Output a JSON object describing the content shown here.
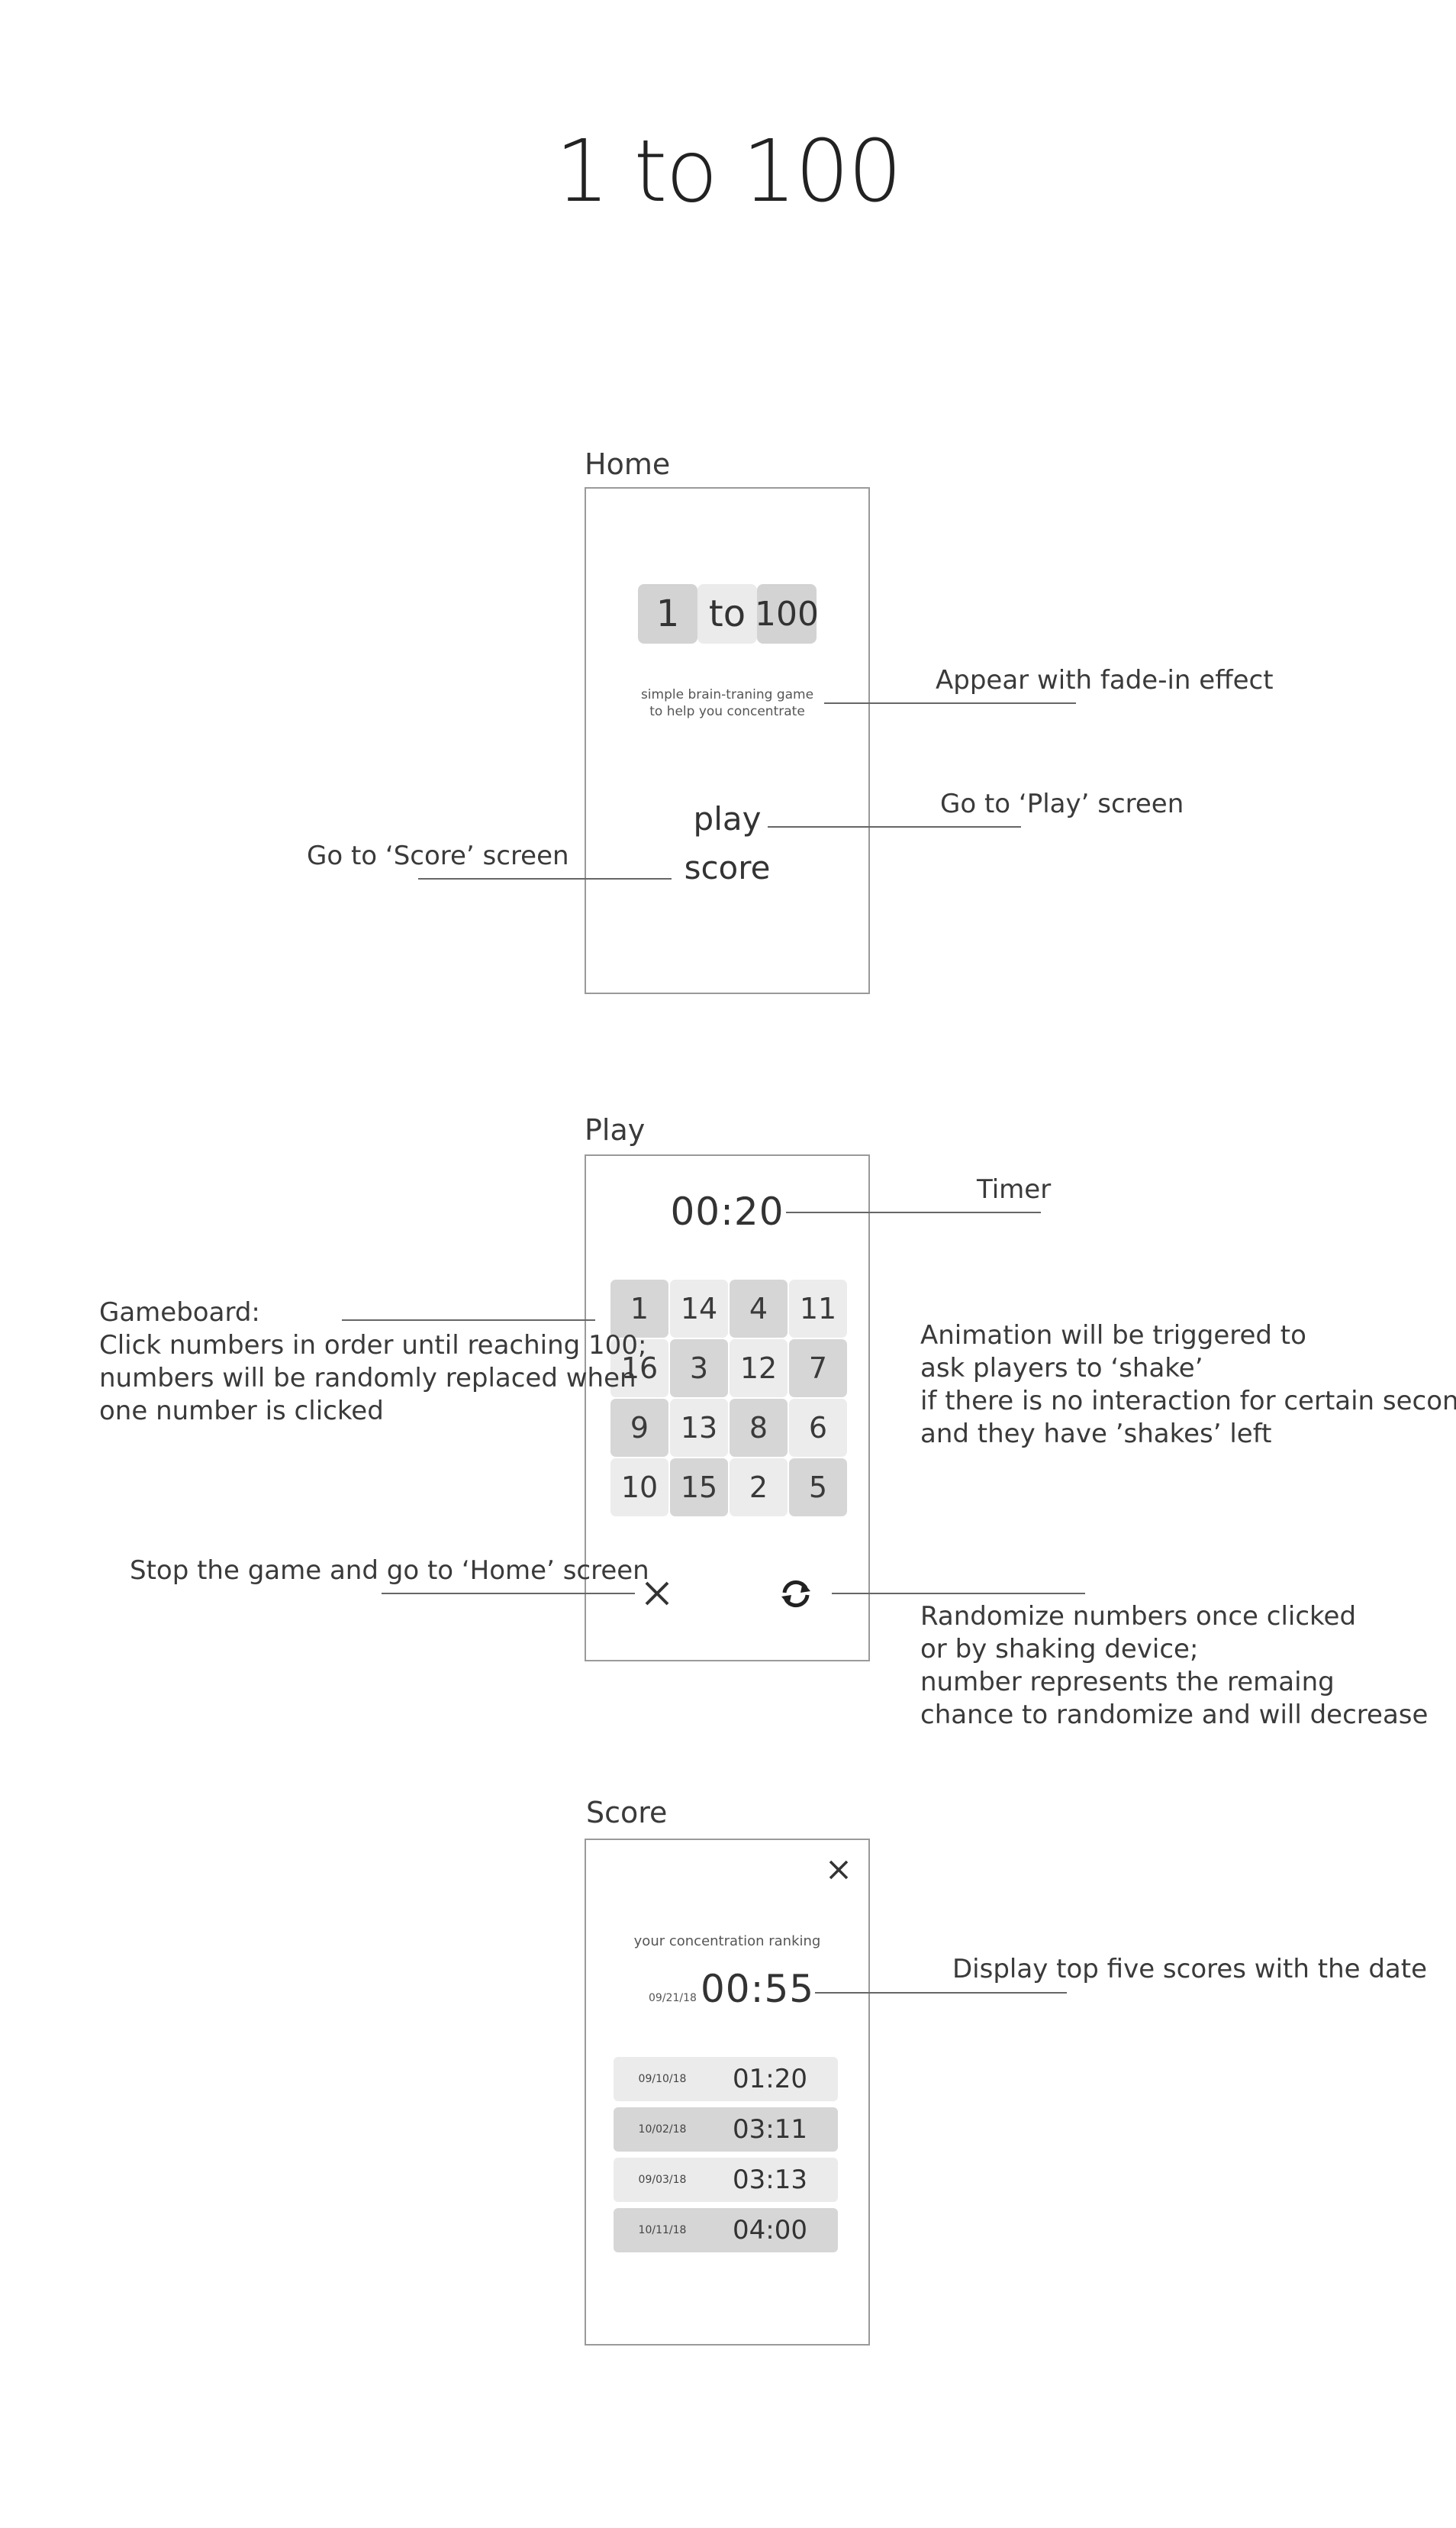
{
  "title": "1 to 100",
  "home": {
    "label": "Home",
    "logo": [
      "1",
      "to",
      "100"
    ],
    "tagline_line1": "simple brain-traning game",
    "tagline_line2": "to help you concentrate",
    "play_link": "play",
    "score_link": "score",
    "notes": {
      "fade": "Appear with fade-in effect",
      "play": "Go to ‘Play’ screen",
      "score": "Go to ‘Score’ screen"
    }
  },
  "play": {
    "label": "Play",
    "timer": "00:20",
    "grid": [
      {
        "n": "1",
        "tone": "dark"
      },
      {
        "n": "14",
        "tone": "light"
      },
      {
        "n": "4",
        "tone": "dark"
      },
      {
        "n": "11",
        "tone": "light"
      },
      {
        "n": "16",
        "tone": "light"
      },
      {
        "n": "3",
        "tone": "dark"
      },
      {
        "n": "12",
        "tone": "light"
      },
      {
        "n": "7",
        "tone": "dark"
      },
      {
        "n": "9",
        "tone": "dark"
      },
      {
        "n": "13",
        "tone": "light"
      },
      {
        "n": "8",
        "tone": "dark"
      },
      {
        "n": "6",
        "tone": "light"
      },
      {
        "n": "10",
        "tone": "light"
      },
      {
        "n": "15",
        "tone": "dark"
      },
      {
        "n": "2",
        "tone": "light"
      },
      {
        "n": "5",
        "tone": "dark"
      }
    ],
    "icons": {
      "close": "close-icon",
      "refresh": "refresh-icon"
    },
    "notes": {
      "timer": "Timer",
      "gameboard": [
        "Gameboard:",
        "Click numbers in order until reaching 100;",
        "numbers will be randomly replaced when",
        "one number is clicked"
      ],
      "shake": [
        "Animation will be triggered to",
        "ask players to ‘shake’",
        "if there is no interaction for certain seconds",
        "and they have ’shakes’ left"
      ],
      "stop": "Stop the game and go to ‘Home’ screen",
      "randomize": [
        "Randomize numbers once clicked",
        "or by shaking device;",
        "number represents the remaing",
        "chance to randomize and will decrease"
      ]
    }
  },
  "score": {
    "label": "Score",
    "caption": "your concentration ranking",
    "top": {
      "date": "09/21/18",
      "time": "00:55"
    },
    "rows": [
      {
        "date": "09/10/18",
        "time": "01:20",
        "tone": "light"
      },
      {
        "date": "10/02/18",
        "time": "03:11",
        "tone": "dark"
      },
      {
        "date": "09/03/18",
        "time": "03:13",
        "tone": "light"
      },
      {
        "date": "10/11/18",
        "time": "04:00",
        "tone": "dark"
      }
    ],
    "note": "Display top five scores with the date"
  }
}
